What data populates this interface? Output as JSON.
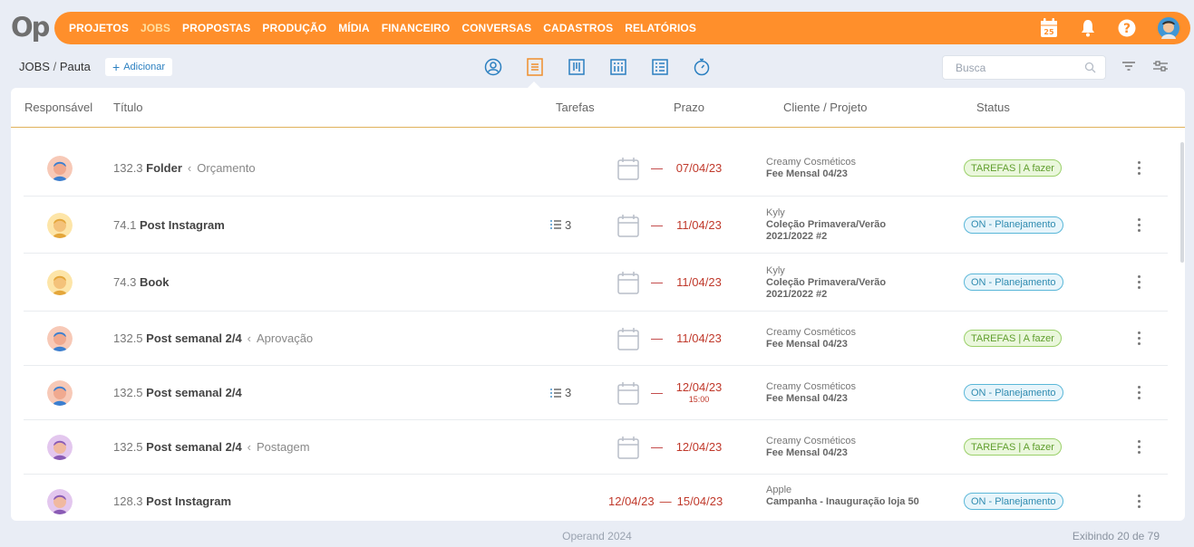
{
  "app": {
    "logo": "Op"
  },
  "nav": {
    "items": [
      "PROJETOS",
      "JOBS",
      "PROPOSTAS",
      "PRODUÇÃO",
      "MÍDIA",
      "FINANCEIRO",
      "CONVERSAS",
      "CADASTROS",
      "RELATÓRIOS"
    ],
    "active": "JOBS",
    "calendar_day": "25",
    "icons": [
      "calendar-icon",
      "bell-icon",
      "help-icon",
      "user-avatar"
    ]
  },
  "breadcrumb": {
    "section": "JOBS",
    "separator": "/",
    "page": "Pauta"
  },
  "add_button": {
    "plus": "+",
    "label": "Adicionar"
  },
  "views": [
    "user-view-icon",
    "list-view-icon",
    "board-view-icon",
    "grid-board-view-icon",
    "checklist-view-icon",
    "timer-view-icon"
  ],
  "search": {
    "placeholder": "Busca"
  },
  "table": {
    "headers": {
      "responsavel": "Responsável",
      "titulo": "Título",
      "tarefas": "Tarefas",
      "prazo": "Prazo",
      "cliente": "Cliente / Projeto",
      "status": "Status"
    },
    "rows": [
      {
        "code": "132.3",
        "name": "Folder",
        "stage": "Orçamento",
        "tasks": "",
        "dash": "—",
        "date": "07/04/23",
        "time": "",
        "client": "Creamy Cosméticos",
        "project": "Fee Mensal 04/23",
        "status": "TAREFAS | A fazer"
      },
      {
        "code": "74.1",
        "name": "Post Instagram",
        "stage": "",
        "tasks": "3",
        "dash": "—",
        "date": "11/04/23",
        "time": "",
        "client": "Kyly",
        "project": "Coleção Primavera/Verão 2021/2022 #2",
        "status": "ON - Planejamento"
      },
      {
        "code": "74.3",
        "name": "Book",
        "stage": "",
        "tasks": "",
        "dash": "—",
        "date": "11/04/23",
        "time": "",
        "client": "Kyly",
        "project": "Coleção Primavera/Verão 2021/2022 #2",
        "status": "ON - Planejamento"
      },
      {
        "code": "132.5",
        "name": "Post semanal 2/4",
        "stage": "Aprovação",
        "tasks": "",
        "dash": "—",
        "date": "11/04/23",
        "time": "",
        "client": "Creamy Cosméticos",
        "project": "Fee Mensal 04/23",
        "status": "TAREFAS | A fazer"
      },
      {
        "code": "132.5",
        "name": "Post semanal 2/4",
        "stage": "",
        "tasks": "3",
        "dash": "—",
        "date": "12/04/23",
        "time": "15:00",
        "client": "Creamy Cosméticos",
        "project": "Fee Mensal 04/23",
        "status": "ON - Planejamento"
      },
      {
        "code": "132.5",
        "name": "Post semanal 2/4",
        "stage": "Postagem",
        "tasks": "",
        "dash": "—",
        "date": "12/04/23",
        "time": "",
        "client": "Creamy Cosméticos",
        "project": "Fee Mensal 04/23",
        "status": "TAREFAS | A fazer"
      },
      {
        "code": "128.3",
        "name": "Post Instagram",
        "stage": "",
        "tasks": "",
        "start": "12/04/23",
        "dash": "—",
        "date": "15/04/23",
        "time": "",
        "client": "Apple",
        "project": "Campanha - Inauguração loja 50",
        "status": "ON - Planejamento"
      }
    ]
  },
  "footer": {
    "center": "Operand 2024",
    "right": "Exibindo 20 de 79"
  },
  "colors": {
    "brand_orange": "#ff8f2b",
    "deadline_red": "#c0392b",
    "status_green": "#5f9e2d",
    "status_blue": "#2f8bb0"
  }
}
